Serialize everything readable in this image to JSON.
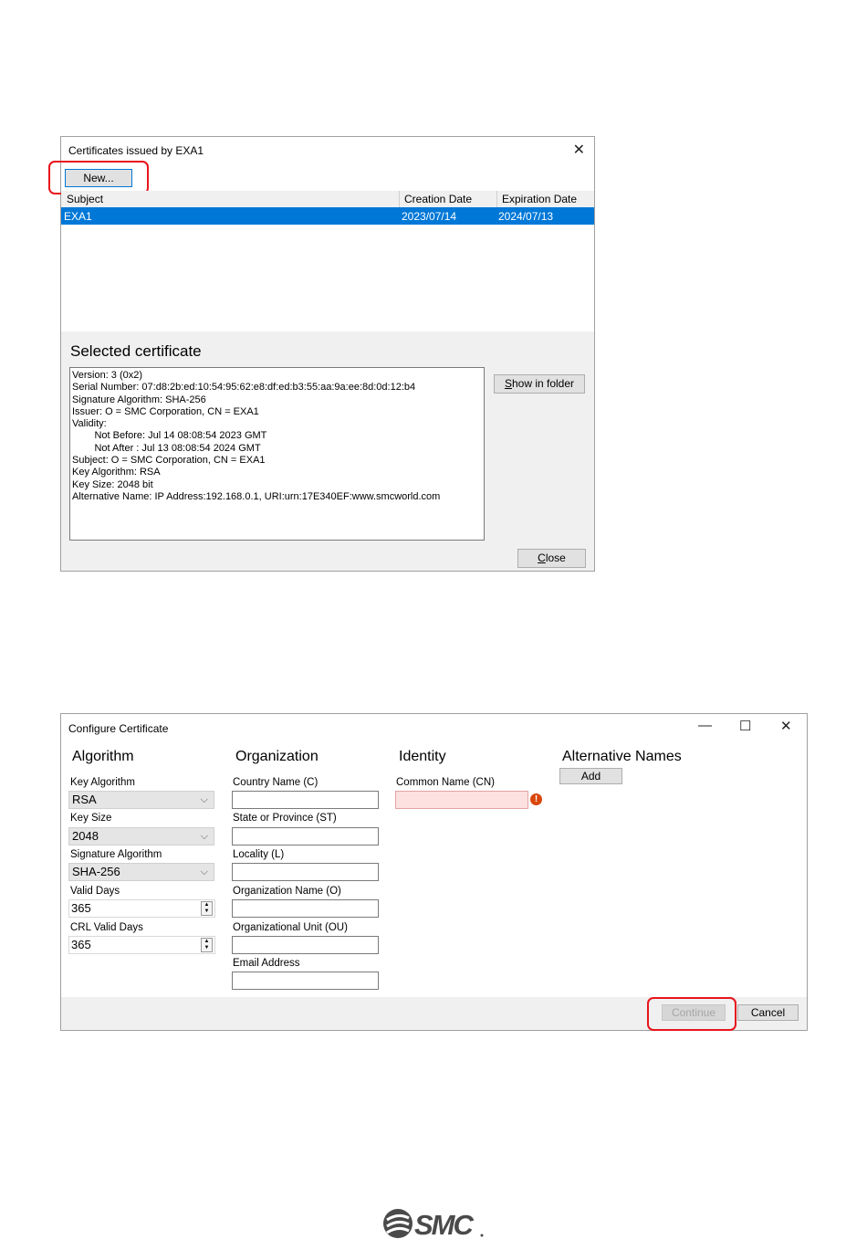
{
  "dialog1": {
    "title": "Certificates issued by EXA1",
    "close_glyph": "✕",
    "new_button": "New...",
    "columns": [
      "Subject",
      "Creation Date",
      "Expiration Date"
    ],
    "rows": [
      {
        "subject": "EXA1",
        "creation": "2023/07/14",
        "expiration": "2024/07/13",
        "selected": true
      }
    ],
    "selected_title": "Selected certificate",
    "details": [
      "Version: 3 (0x2)",
      "Serial Number: 07:d8:2b:ed:10:54:95:62:e8:df:ed:b3:55:aa:9a:ee:8d:0d:12:b4",
      "Signature Algorithm: SHA-256",
      "Issuer: O = SMC Corporation, CN = EXA1",
      "Validity:",
      "        Not Before: Jul 14 08:08:54 2023 GMT",
      "        Not After : Jul 13 08:08:54 2024 GMT",
      "Subject: O = SMC Corporation, CN = EXA1",
      "Key Algorithm: RSA",
      "Key Size: 2048 bit",
      "Alternative Name: IP Address:192.168.0.1, URI:urn:17E340EF:www.smcworld.com"
    ],
    "show_in_folder": "Show in folder",
    "close_button": "Close"
  },
  "dialog2": {
    "title": "Configure Certificate",
    "controls": {
      "minimize": "—",
      "maximize": "☐",
      "close": "✕"
    },
    "sections": {
      "algorithm": "Algorithm",
      "organization": "Organization",
      "identity": "Identity",
      "alternative_names": "Alternative Names"
    },
    "algorithm": {
      "key_algorithm_label": "Key Algorithm",
      "key_algorithm_value": "RSA",
      "key_size_label": "Key Size",
      "key_size_value": "2048",
      "signature_algorithm_label": "Signature Algorithm",
      "signature_algorithm_value": "SHA-256",
      "valid_days_label": "Valid Days",
      "valid_days_value": "365",
      "crl_valid_days_label": "CRL Valid Days",
      "crl_valid_days_value": "365"
    },
    "organization": {
      "country_label": "Country Name (C)",
      "state_label": "State or Province (ST)",
      "locality_label": "Locality (L)",
      "org_name_label": "Organization Name (O)",
      "org_unit_label": "Organizational Unit (OU)",
      "email_label": "Email Address"
    },
    "identity": {
      "common_name_label": "Common Name (CN)",
      "error_glyph": "!"
    },
    "add_button": "Add",
    "continue_button": "Continue",
    "cancel_button": "Cancel"
  },
  "logo_text": "SMC",
  "colors": {
    "selection": "#0078d7",
    "highlight": "#e8141c",
    "error_field": "#fde0e0",
    "dialog_bg": "#f0f0f0"
  }
}
